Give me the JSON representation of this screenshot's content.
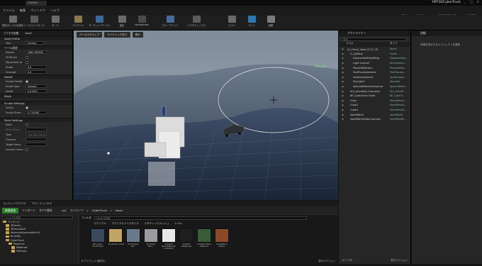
{
  "window": {
    "tab_title": "Untitled Project",
    "project_name": "YMT3DCyberTruck",
    "controls": "_ ▢ ✕"
  },
  "menu": [
    "ファイル",
    "編集",
    "ウィンドウ",
    "ヘルプ"
  ],
  "stats": {
    "fps": "60.1",
    "ms": "16.6 ms",
    "mem": "2067.92 MB",
    "objects": "40,322"
  },
  "toolbar": [
    {
      "label": "現在のレベルを保存",
      "color": "#6a6a6a"
    },
    {
      "label": "ソースコントロール",
      "color": "#5a5a5a"
    },
    {
      "label": "モード",
      "color": "#6a6a6a"
    },
    {
      "label": "コンテンツ",
      "color": "#8a7a4a"
    },
    {
      "label": "マーケットプレイス",
      "color": "#3a6a9a"
    },
    {
      "label": "設定",
      "color": "#6a6a6a"
    },
    {
      "label": "Hemisphere",
      "color": "#4a4a4a"
    },
    {
      "label": "ブループリント",
      "color": "#4a6a9a"
    },
    {
      "label": "シネマティックス",
      "color": "#5a5a5a"
    },
    {
      "label": "ビルド",
      "color": "#6a6a6a"
    },
    {
      "label": "プレイ",
      "color": "#2a7ab0"
    },
    {
      "label": "起動",
      "color": "#7a7a7a"
    }
  ],
  "left_panel": {
    "modes": [
      "アクタを配置",
      "Voxel"
    ],
    "voxel_editor": "Voxel Editor",
    "tool_label": "Tool",
    "tool_value": "Surface",
    "tool_settings": "ツール設定",
    "radius_label": "Radius",
    "radius_value": "2662.983959",
    "ds_brush": "3D Brush",
    "movement_ai": "Movement AI",
    "stride_label": "Stride",
    "stride_value": "0.0",
    "strength_label": "Strength",
    "strength_value": "0.0",
    "falloff": "Falloff",
    "enable_falloff": "Enable Falloff",
    "falloff_type": "Falloff Type",
    "falloff_type_value": "Smooth",
    "falloff_label": "Falloff",
    "falloff_value": "0.47619",
    "mask": "Mask",
    "sculpt_settings": "Sculpt Settings",
    "sculpt": "Sculpt",
    "sculpt_strength": "Sculpt Stren...",
    "sculpt_strength_value": "0.719168",
    "paint_settings": "Paint Settings",
    "paint": "Paint",
    "paint_strength": "Paint Stren...",
    "type": "Type",
    "type_value": "Five Max Blend",
    "channel": "Channel",
    "target_value": "Target Value",
    "locked_chann": "Locked Chann..."
  },
  "viewport": {
    "perspective": "パースペクティブ",
    "lit": "ライティングあり",
    "show": "表示",
    "icons": [
      "⟲",
      "◎",
      "⇔",
      "100",
      "10°",
      "0.25",
      "4"
    ],
    "sky_label": "SkyLight"
  },
  "outliner": {
    "tab": "アウトライナー",
    "search_placeholder": "検索...",
    "col_label": "ラベル",
    "col_type": "タイプ",
    "rows": [
      {
        "name": "LV_Check_Voxel (エディタ)",
        "type": "World",
        "indent": 0
      },
      {
        "name": "0_Lighting",
        "type": "Folder",
        "indent": 1
      },
      {
        "name": "ExponentialHeightFog",
        "type": "ExponentialH...",
        "indent": 2
      },
      {
        "name": "Light Source2",
        "type": "DirectionalLi...",
        "indent": 2
      },
      {
        "name": "PlanarReflection",
        "type": "PlanarReflec...",
        "indent": 2
      },
      {
        "name": "PostProcessVolume",
        "type": "PostProcess...",
        "indent": 2
      },
      {
        "name": "SkyAtmosphere2",
        "type": "SkyAtmosph...",
        "indent": 2
      },
      {
        "name": "SkyLight2",
        "type": "SkyLight",
        "indent": 2
      },
      {
        "name": "SphereReflectionCapture",
        "type": "SphereReflec...",
        "indent": 2
      },
      {
        "name": "ALS_AnimMan_Character",
        "type": "ALS_AnimM...",
        "indent": 1
      },
      {
        "name": "BP_CyberTruck-Fixed",
        "type": "BP_CyberTr...",
        "indent": 1
      },
      {
        "name": "Cube",
        "type": "StaticMeshA...",
        "indent": 1
      },
      {
        "name": "Cube2",
        "type": "StaticMeshA...",
        "indent": 1
      },
      {
        "name": "Cube3",
        "type": "StaticMeshA...",
        "indent": 1
      },
      {
        "name": "VoxelWorld",
        "type": "VoxelWorld",
        "indent": 1
      },
      {
        "name": "VoxelWorldEditorControls",
        "type": "VoxelWorldE...",
        "indent": 1
      }
    ],
    "footer": "14 アクタ",
    "view_options": "表示オプション"
  },
  "details": {
    "tab": "詳細",
    "hint": "詳細を表示するオブジェクトを選択"
  },
  "bottom": {
    "tabs": [
      "コンテンツブラウザ",
      "アウトプットログ"
    ],
    "add_new": "新規追加",
    "import": "インポート",
    "save_all": "すべて保存",
    "breadcrumb": [
      "コンテンツ",
      "CyberTruck",
      "Voxel"
    ],
    "tree_search": "フォルダを検索",
    "tree": [
      "コンテンツ",
      "3DInchu",
      "3DInchuALM",
      "AdvancedLocomotionV4",
      "BrushDy",
      "CyberTruck",
      "Resource",
      "Materials",
      "Textures"
    ],
    "filter_label": "フィルタ",
    "asset_search": "Voxel を検索",
    "filters": [
      "マテリアル",
      "マテリアルインスタンス",
      "スタティックメッシュ",
      "レベル"
    ],
    "assets": [
      {
        "name": "BP_Cyber Truck-Fixed",
        "color": "#3b4a5a"
      },
      {
        "name": "LV_Check_Voxel",
        "color": "#c2a565"
      },
      {
        "name": "M_Checker Bld..",
        "color": "#6a7a8a"
      },
      {
        "name": "M_Check Nrm...",
        "color": "#9a9aa0"
      },
      {
        "name": "Voxeled BlockMaterial Collection",
        "color": "#e8e8e8"
      },
      {
        "name": "Voxeled Dataprops",
        "color": "#1f1f1f"
      },
      {
        "name": "Voxeled Mesh Material",
        "color": "#3a5a3a"
      },
      {
        "name": "VoxelWorld Object",
        "color": "#8a4a2a"
      }
    ],
    "footer": "8 アイテム (1 選択中)",
    "view_options": "表示オプション"
  }
}
